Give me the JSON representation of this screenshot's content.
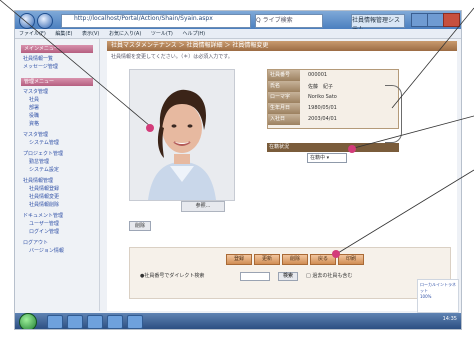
{
  "browser": {
    "address": "http://localhost/Portal/Action/Shain/Syain.aspx",
    "search_placeholder": "Q  ライブ検索",
    "tab_label": "社員情報管理システム",
    "menu": [
      "ファイル(F)",
      "編集(E)",
      "表示(V)",
      "お気に入り(A)",
      "ツール(T)",
      "ヘルプ(H)"
    ]
  },
  "sidebar": {
    "sections": [
      {
        "title": "メインメニュー",
        "items": [
          "社員情報一覧",
          "メッセージ管理"
        ]
      },
      {
        "title": "管理メニュー",
        "items": [
          "マスタ管理",
          "社員",
          "部署",
          "役職",
          "資格",
          "マスタ管理",
          "システム管理",
          "プロジェクト管理",
          "勤怠管理",
          "システム設定",
          "社員情報管理",
          "社員情報登録",
          "社員情報変更",
          "社員情報削除",
          "ドキュメント管理",
          "ユーザー管理",
          "ログイン管理",
          "ログアウト",
          "バージョン情報"
        ]
      }
    ]
  },
  "main": {
    "title": "社員マスタメンテナンス ＞ 社員情報詳細 ＞ 社員情報変更",
    "subtitle": "社員情報を変更してください。（＊）は必須入力です。",
    "photo_caption": "参照...",
    "delete_button": "削除",
    "info_table": {
      "rows": [
        {
          "key": "社員番号",
          "value": "000001"
        },
        {
          "key": "氏名",
          "value": "佐藤　紀子"
        },
        {
          "key": "ローマ字",
          "value": "Noriko Sato"
        },
        {
          "key": "生年月日",
          "value": "1980/05/01"
        },
        {
          "key": "入社日",
          "value": "2003/04/01"
        }
      ]
    },
    "state_bar_label": "在籍状況",
    "state_select_value": "在籍中 ▾",
    "action_buttons": [
      "登録",
      "更新",
      "削除",
      "戻る",
      "印刷"
    ],
    "search_label": "●社員番号でダイレクト検索",
    "search_button": "検索",
    "checkbox_label": "□ 過去の社員も含む"
  },
  "corner_card": {
    "line1": "ローカルイントラネット",
    "line2": "100%"
  },
  "taskbar": {
    "clock": "14:35"
  }
}
